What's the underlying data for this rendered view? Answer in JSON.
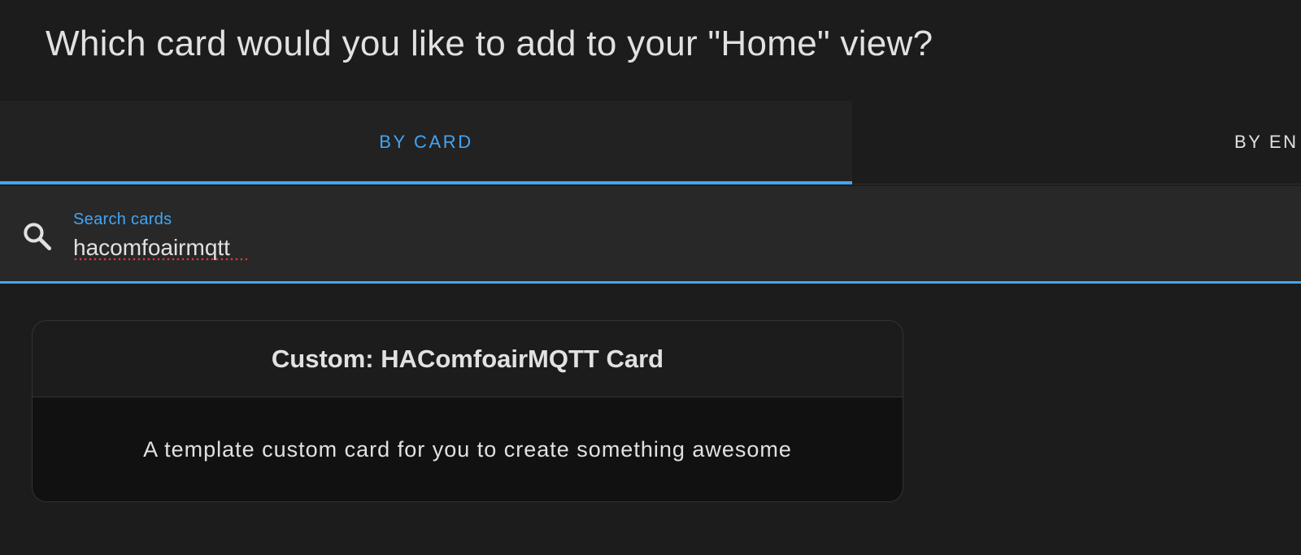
{
  "dialog": {
    "title": "Which card would you like to add to your \"Home\" view?"
  },
  "tabs": [
    {
      "label": "BY CARD",
      "active": true
    },
    {
      "label": "BY EN",
      "active": false
    }
  ],
  "search": {
    "label": "Search cards",
    "value": "hacomfoairmqtt",
    "icon": "search-icon"
  },
  "results": [
    {
      "title": "Custom: HAComfoairMQTT Card",
      "description": "A template custom card for you to create something awesome"
    }
  ],
  "colors": {
    "accent": "#42a5f5",
    "background": "#1c1c1c",
    "text": "#e1e1e1"
  }
}
